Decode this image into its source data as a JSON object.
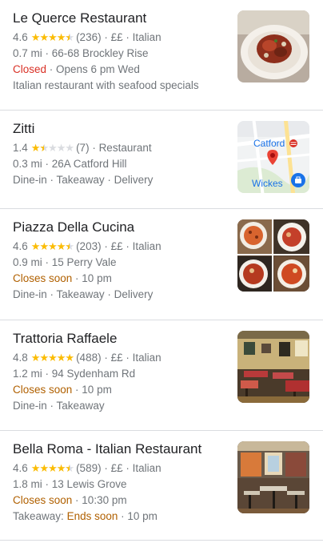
{
  "results": [
    {
      "name": "Le Querce Restaurant",
      "rating": "4.6",
      "stars": [
        1,
        1,
        1,
        1,
        0.5
      ],
      "reviews": "(236)",
      "price": "££",
      "category": "Italian",
      "distance": "0.7 mi",
      "address": "66-68 Brockley Rise",
      "status": "Closed",
      "status_detail": "Opens 6 pm Wed",
      "extra": "Italian restaurant with seafood specials"
    },
    {
      "name": "Zitti",
      "rating": "1.4",
      "stars": [
        1,
        0.5,
        0,
        0,
        0
      ],
      "reviews": "(7)",
      "category": "Restaurant",
      "distance": "0.3 mi",
      "address": "26A Catford Hill",
      "services": [
        "Dine-in",
        "Takeaway",
        "Delivery"
      ],
      "map_labels": [
        "Catford",
        "Wickes"
      ]
    },
    {
      "name": "Piazza Della Cucina",
      "rating": "4.6",
      "stars": [
        1,
        1,
        1,
        1,
        0.5
      ],
      "reviews": "(203)",
      "price": "££",
      "category": "Italian",
      "distance": "0.9 mi",
      "address": "15 Perry Vale",
      "status": "Closes soon",
      "status_detail": "10 pm",
      "services": [
        "Dine-in",
        "Takeaway",
        "Delivery"
      ]
    },
    {
      "name": "Trattoria Raffaele",
      "rating": "4.8",
      "stars": [
        1,
        1,
        1,
        1,
        1
      ],
      "reviews": "(488)",
      "price": "££",
      "category": "Italian",
      "distance": "1.2 mi",
      "address": "94 Sydenham Rd",
      "status": "Closes soon",
      "status_detail": "10 pm",
      "services": [
        "Dine-in",
        "Takeaway"
      ]
    },
    {
      "name": "Bella Roma - Italian Restaurant",
      "rating": "4.6",
      "stars": [
        1,
        1,
        1,
        1,
        0.5
      ],
      "reviews": "(589)",
      "price": "££",
      "category": "Italian",
      "distance": "1.8 mi",
      "address": "13 Lewis Grove",
      "status": "Closes soon",
      "status_detail": "10:30 pm",
      "service_prefix": "Takeaway:",
      "service_status": "Ends soon",
      "service_detail": "10 pm"
    }
  ],
  "colors": {
    "star": "#fbbc04",
    "closed": "#d93025",
    "closes_soon": "#b06000",
    "muted": "#70757a"
  }
}
